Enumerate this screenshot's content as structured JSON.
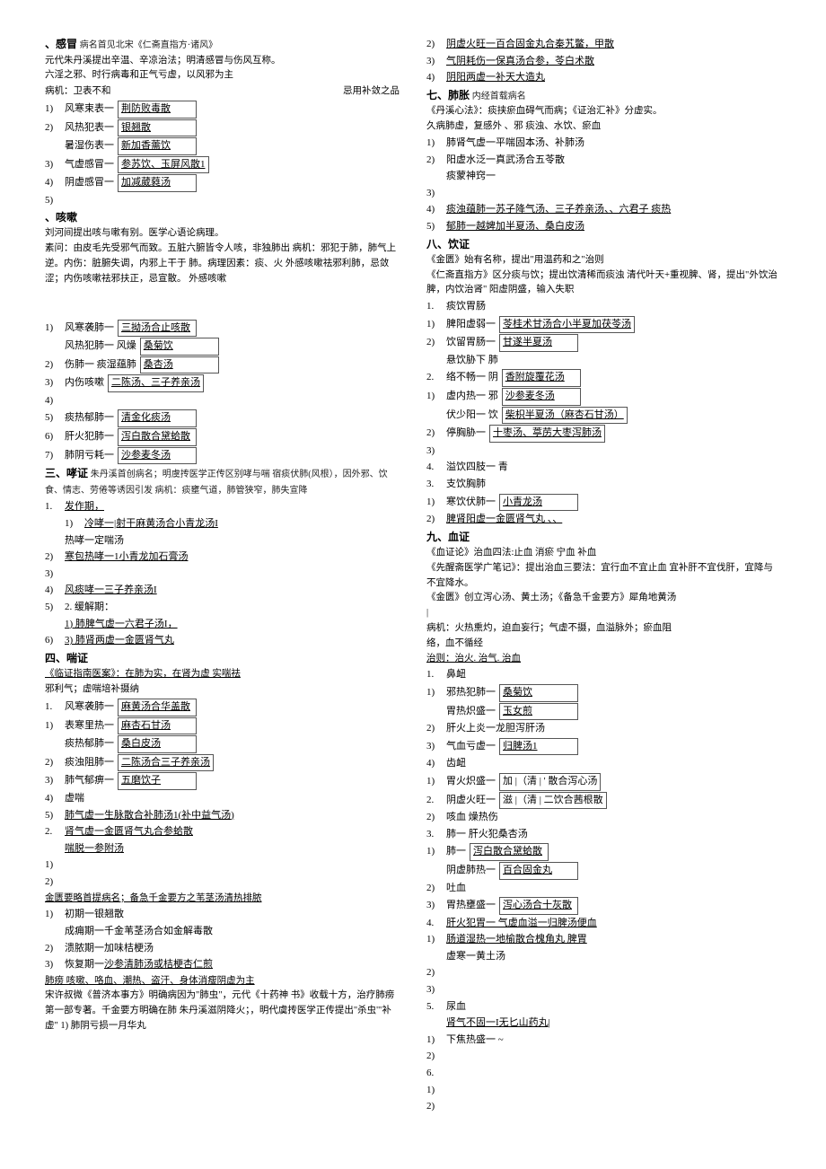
{
  "left": {
    "s1": {
      "title": "、感冒",
      "src": "病名首见北宋《仁斋直指方·诸风》",
      "n1": "元代朱丹溪提出辛温、辛凉治法；明清感冒与伤风互称。",
      "n2": "六淫之邪、时行病毒和正气亏虚，以风邪为主",
      "n3a": "病机：卫表不和",
      "n3b": "忌用补敛之品",
      "items": [
        {
          "n": "1)",
          "l": "风寒束表一",
          "b": "荆防败毒散"
        },
        {
          "n": "2)",
          "l": "风热犯表一",
          "b": "银翘散"
        },
        {
          "n": "",
          "l": "暑湿伤表一",
          "b": "新加香薷饮"
        },
        {
          "n": "3)",
          "l": "气虚感冒一",
          "b": "参苏饮、玉屏风散1"
        },
        {
          "n": "4)",
          "l": "阴虚感冒一",
          "b": "加减葳蕤汤"
        }
      ],
      "tail": "5)"
    },
    "s2": {
      "title": "、咳嗽",
      "n1": "刘河间提出咳与嗽有别。医学心语论病理。",
      "n2": "素问：由皮毛先受邪气而致。五脏六腑皆令人咳，非独肺出 病机：邪犯于肺，肺气上逆。内伤：脏腑失调，内邪上干于 肺。病理因素：痰、火 外感咳嗽祛邪利肺，忌敛涩；内伤咳嗽祛邪扶正，忌宣散。    外感咳嗽",
      "items": [
        {
          "n": "1)",
          "l": "风寒袭肺一",
          "b": "三拗汤合止咳散"
        },
        {
          "n": "",
          "l": "风热犯肺一    风燥",
          "b": "桑菊饮"
        },
        {
          "n": "2)",
          "l": "伤肺一    痰湿蕴肺",
          "b": "桑杏汤"
        },
        {
          "n": "3)",
          "l": "内伤咳嗽",
          "b": "二陈汤、三子养亲汤"
        },
        {
          "n": "4)",
          "l": "",
          "b": ""
        },
        {
          "n": "5)",
          "l": "痰热郁肺一",
          "b": "清金化痰汤"
        },
        {
          "n": "6)",
          "l": "肝火犯肺一",
          "b": "泻白散合黛蛤散"
        },
        {
          "n": "7)",
          "l": "肺阴亏耗一",
          "b": "沙参麦冬汤"
        }
      ]
    },
    "s3": {
      "title": "三、哮证",
      "src": "朱丹溪首创病名；明虞抟医学正传区别哮与喘 宿痰伏肺(风根），因外邪、饮食、情志、劳倦等诱因引发 病机：痰壅气道，肺管狭窄，肺失宣降",
      "items": [
        {
          "n": "1.",
          "l": "发作期，",
          "b": ""
        },
        {
          "n": "1)",
          "l": "冷哮一|射干麻黄汤合小青龙汤I",
          "b": ""
        },
        {
          "n": "",
          "l": "热哮一定喘汤",
          "b": ""
        },
        {
          "n": "2)",
          "l": "寒包热哮一1小青龙加石膏汤",
          "b": ""
        },
        {
          "n": "3)",
          "l": "",
          "b": ""
        },
        {
          "n": "4)",
          "l": "风痰哮一三子养亲汤I",
          "b": ""
        },
        {
          "n": "5)",
          "l": "2. 缓解期：",
          "b": ""
        },
        {
          "n": "",
          "l": "1) 肺脾气虚一六君子汤I，",
          "b": ""
        },
        {
          "n": "6)",
          "l": "3) 肺肾两虚一金匮肾气丸",
          "b": ""
        }
      ]
    },
    "s4": {
      "title": "四、喘证",
      "src": "《临证指南医案》：在肺为实，在肾为虚 实喘祛",
      "n1": "邪利气；虚喘培补摄纳",
      "items": [
        {
          "n": "1.",
          "l": "风寒袭肺一",
          "b": "麻黄汤合华盖散"
        },
        {
          "n": "1)",
          "l": "表寒里热一",
          "b": "麻杏石甘汤"
        },
        {
          "n": "",
          "l": "痰热郁肺一",
          "b": "桑白皮汤"
        },
        {
          "n": "2)",
          "l": "痰浊阻肺一",
          "b": "二陈汤合三子养亲汤"
        },
        {
          "n": "3)",
          "l": "肺气郁痹一",
          "b": "五磨饮子"
        },
        {
          "n": "4)",
          "l": "虚喘",
          "b": ""
        },
        {
          "n": "5)",
          "l": "肺气虚一生脉散合补肺汤1(补中益气汤)",
          "b": ""
        },
        {
          "n": "2.",
          "l": "肾气虚一金匮肾气丸合参蛤散",
          "b": ""
        },
        {
          "n": "",
          "l": "喘脱一参附汤",
          "b": ""
        },
        {
          "n": "1)",
          "l": "",
          "b": ""
        },
        {
          "n": "2)",
          "l": "",
          "b": ""
        }
      ]
    },
    "s5": {
      "title": "金匮要略首提病名；备急千金要方之苇茎汤清热排脓",
      "items": [
        {
          "n": "1)",
          "l": "初期一",
          "b": "银翘散"
        },
        {
          "n": "",
          "l": "成痈期一",
          "b": "千金苇茎汤合如金解毒散"
        },
        {
          "n": "2)",
          "l": "溃脓期一",
          "b": "加味桔梗汤"
        },
        {
          "n": "3)",
          "l": "恢复期一",
          "b": "沙参清肺汤或桔梗杏仁煎"
        }
      ],
      "tail": "肺痨 咳嗽、咯血、潮热、盗汗、身体消瘦阴虚为主",
      "n2": "宋许叔微《普济本事方》明确病因为\"肺虫\"，元代《十药神 书》收载十方，治疗肺痨第一部专著。千金要方明确在肺 朱丹溪滋阴降火；，明代虞抟医学正传提出\"杀虫'\"补虚\" 1) 肺阴亏损一月华丸"
    }
  },
  "right": {
    "pre": [
      {
        "n": "2)",
        "l": "阴虚火旺一百合固金丸合秦艽鳖，甲散"
      },
      {
        "n": "3)",
        "l": "气阴耗伤一保真汤合参，苓白术散"
      },
      {
        "n": "4)",
        "l": "阴阳两虚一补天大造丸"
      }
    ],
    "s7": {
      "title": "七、肺胀",
      "src": "内经首载病名",
      "n1": "《丹溪心法》：痰挟瘀血碍气而病；《证治汇补》分虚实。",
      "n2": "久病肺虚，复感外        、邪 痰浊、水饮、瘀血",
      "items": [
        {
          "n": "1)",
          "l": "肺肾气虚一",
          "t": "平喘固本汤、补肺汤"
        },
        {
          "n": "2)",
          "l": "阳虚水泛一",
          "t": "真武汤合五苓散"
        },
        {
          "n": "",
          "l": "痰蒙神窍一",
          "t": ""
        },
        {
          "n": "3)",
          "l": "",
          "t": ""
        },
        {
          "n": "4)",
          "l": "痰浊蕴肺一苏子降气汤、三子养亲汤、、六君子 痰热",
          "t": ""
        },
        {
          "n": "5)",
          "l": "郁肺一越婢加半夏汤、桑白皮汤",
          "t": ""
        }
      ]
    },
    "s8": {
      "title": "八、饮证",
      "n1": "《金匮》始有名称，提出\"用温药和之\"治则",
      "n2": "《仁斋直指方》区分痰与饮；提出饮清稀而痰浊 清代叶天+重视脾、肾，提出\"外饮治脾，内饮治肾\" 阳虚阴盛，输入失职",
      "items": [
        {
          "n": "1.",
          "l": "痰饮胃肠",
          "t": ""
        },
        {
          "n": "1)",
          "l": "脾阳虚弱一",
          "b": "苓桂术甘汤合小半夏加茯苓汤"
        },
        {
          "n": "2)",
          "l": "饮留胃肠一",
          "b": "甘遂半夏汤"
        },
        {
          "n": "",
          "l": "悬饮胁下    肺",
          "t": ""
        },
        {
          "n": "2.",
          "l": "络不畅一    阴",
          "b": "香附旋覆花汤"
        },
        {
          "n": "1)",
          "l": "虚内热一    邪",
          "b": "沙参麦冬汤"
        },
        {
          "n": "",
          "l": "伏少阳一    饮",
          "b": "柴枳半夏汤（麻杏石甘汤）"
        },
        {
          "n": "2)",
          "l": "停胸胁一",
          "b": "十枣汤、葶苈大枣泻肺汤"
        },
        {
          "n": "3)",
          "l": "",
          "t": ""
        },
        {
          "n": "4.",
          "l": "溢饮四肢一            青",
          "t": ""
        },
        {
          "n": "3.",
          "l": "支饮胸肺",
          "t": ""
        },
        {
          "n": "1)",
          "l": "寒饮伏肺一",
          "b": "小青龙汤"
        },
        {
          "n": "2)",
          "l": "脾肾阳虚一金匮肾气丸    、、",
          "t": ""
        }
      ]
    },
    "s9": {
      "title": "九、血证",
      "n1": "《血证论》治血四法:止血 消瘀 宁血 补血",
      "n2": "《先醒斋医学广笔记》：提出治血三要法：宜行血不宜止血 宜补肝不宜伐肝，宜降与不宜降水。",
      "n3": "《金匮》创立泻心汤、黄土汤；《备急千金要方》犀角地黄汤",
      "n4": "|",
      "n5": "病机：火热熏灼，迫血妄行；气虚不摄，血溢脉外；瘀血阻",
      "n6": "络，血不循经",
      "n7": "治则：治火. 治气. 治血",
      "items": [
        {
          "n": "1.",
          "l": "鼻衄",
          "t": ""
        },
        {
          "n": "1)",
          "l": "邪热犯肺一",
          "b": "桑菊饮"
        },
        {
          "n": "",
          "l": "胃热炽盛一",
          "b": "玉女煎"
        },
        {
          "n": "2)",
          "l": "肝火上炎一",
          "t": "龙胆泻肝汤"
        },
        {
          "n": "3)",
          "l": "气血亏虚一",
          "b": "归脾汤1"
        },
        {
          "n": "4)",
          "l": "齿衄",
          "t": ""
        },
        {
          "n": "1)",
          "l": "胃火炽盛一",
          "b": "加      |（清    | ' 散合泻心汤"
        },
        {
          "n": "2.",
          "l": "阴虚火旺一",
          "b": "滋      |（清    | 二饮合茜根散"
        },
        {
          "n": "2)",
          "l": "咳血 燥热伤",
          "t": ""
        },
        {
          "n": "3.",
          "l": "肺一    肝火犯",
          "t": "桑杏汤"
        },
        {
          "n": "1)",
          "l": "肺一",
          "b": "泻白散合黛蛤散"
        },
        {
          "n": "",
          "l": "阴虚肺热一",
          "b": "百合固金丸"
        },
        {
          "n": "2)",
          "l": "吐血",
          "t": ""
        },
        {
          "n": "3)",
          "l": "胃热壅盛一",
          "b": "泻心汤合十灰散"
        },
        {
          "n": "4.",
          "l": "肝火犯胃一 气虚血溢一归脾汤便血",
          "t": ""
        },
        {
          "n": "1)",
          "l": "肠道湿热一地榆散合槐角丸    脾胃",
          "t": ""
        },
        {
          "n": "",
          "l": "虚寒一黄土汤",
          "t": ""
        },
        {
          "n": "2)",
          "l": "",
          "t": ""
        },
        {
          "n": "3)",
          "l": "",
          "t": ""
        },
        {
          "n": "5.",
          "l": "尿血",
          "t": ""
        },
        {
          "n": "",
          "l": "肾气不固一I无匕山药丸|",
          "t": ""
        },
        {
          "n": "1)",
          "l": "下焦热盛一                            ~",
          "t": ""
        },
        {
          "n": "2)",
          "l": "",
          "t": ""
        },
        {
          "n": "6.",
          "l": "",
          "t": ""
        },
        {
          "n": "1)",
          "l": "",
          "t": ""
        },
        {
          "n": "2)",
          "l": "",
          "t": ""
        }
      ]
    }
  }
}
